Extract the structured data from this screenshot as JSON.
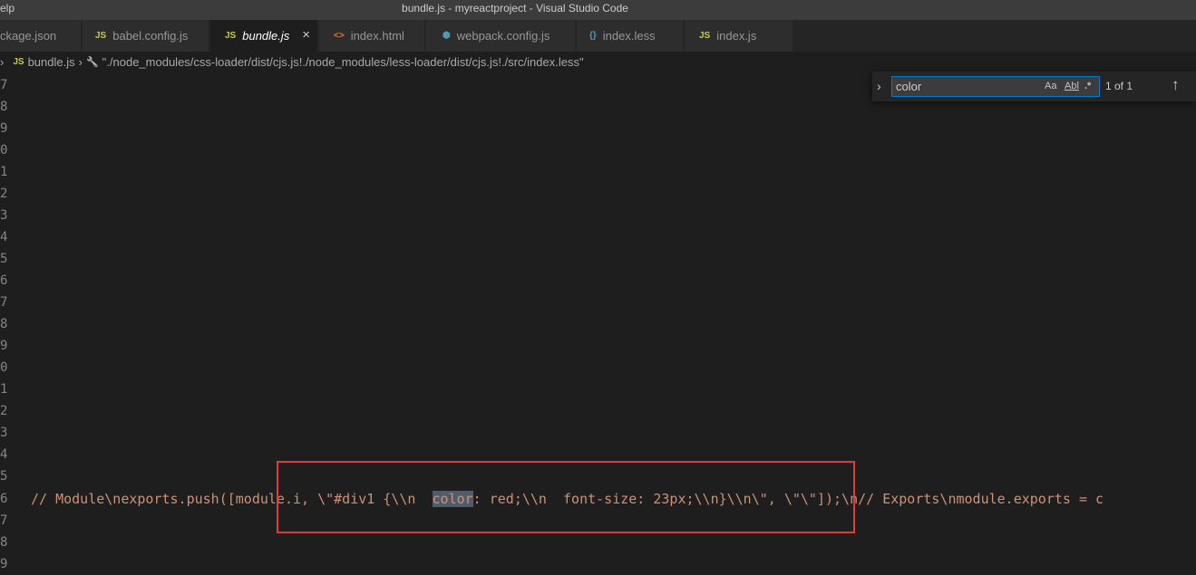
{
  "titlebar": {
    "menu_fragment": "elp",
    "title": "bundle.js - myreactproject - Visual Studio Code"
  },
  "tabs": [
    {
      "label": "ckage.json",
      "icon": "json-file-icon"
    },
    {
      "label": "babel.config.js",
      "icon": "js-file-icon",
      "icon_text": "JS"
    },
    {
      "label": "bundle.js",
      "icon": "js-file-icon",
      "icon_text": "JS",
      "active": true,
      "close": "×"
    },
    {
      "label": "index.html",
      "icon": "html-file-icon",
      "icon_text": "<>"
    },
    {
      "label": "webpack.config.js",
      "icon": "webpack-file-icon",
      "icon_text": "⬢"
    },
    {
      "label": "index.less",
      "icon": "less-file-icon",
      "icon_text": "{}"
    },
    {
      "label": "index.js",
      "icon": "js-file-icon",
      "icon_text": "JS"
    }
  ],
  "breadcrumb": {
    "chevron": "›",
    "file_icon_text": "JS",
    "file": "bundle.js",
    "sep": "›",
    "wrench": "🔧",
    "path": "\"./node_modules/css-loader/dist/cjs.js!./node_modules/less-loader/dist/cjs.js!./src/index.less\""
  },
  "line_numbers": [
    "7",
    "8",
    "9",
    "0",
    "1",
    "2",
    "3",
    "4",
    "5",
    "6",
    "7",
    "8",
    "9",
    "0",
    "1",
    "2",
    "3",
    "4",
    "5",
    "6",
    "7",
    "8",
    "9"
  ],
  "code": {
    "before": "// Module\\nexports.push([module.i, \\\"#div1 {\\\\n  ",
    "match": "color",
    "after": ": red;\\\\n  font-size: 23px;\\\\n}\\\\n\\\", \\\"\\\"]);\\n// Exports\\nmodule.exports = c"
  },
  "find_widget": {
    "toggle": "›",
    "query": "color",
    "match_case": "Aa",
    "whole_word": "Abl",
    "regex": ".*",
    "count": "1 of 1",
    "prev": "↑"
  },
  "colors": {
    "annotation_box": "#e53935",
    "accent": "#007acc"
  }
}
